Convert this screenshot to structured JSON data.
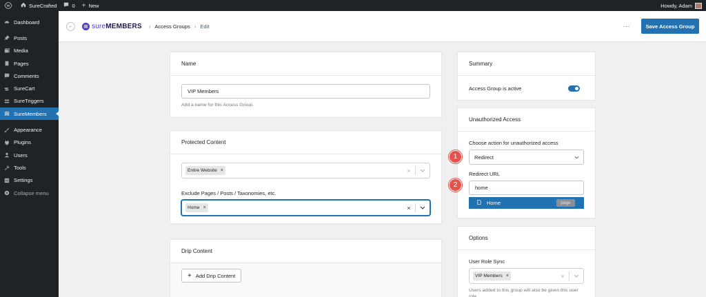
{
  "admin_bar": {
    "site_name": "SureCrafted",
    "comments_count": "0",
    "new_label": "New",
    "howdy": "Howdy, Adam"
  },
  "sidebar": {
    "items": [
      {
        "label": "Dashboard",
        "icon": "dashboard-icon"
      },
      {
        "label": "Posts",
        "icon": "pin-icon"
      },
      {
        "label": "Media",
        "icon": "media-icon"
      },
      {
        "label": "Pages",
        "icon": "pages-icon"
      },
      {
        "label": "Comments",
        "icon": "comment-icon"
      },
      {
        "label": "SureCart",
        "icon": "surecart-icon"
      },
      {
        "label": "SureTriggers",
        "icon": "suretriggers-icon"
      },
      {
        "label": "SureMembers",
        "icon": "suremembers-icon"
      },
      {
        "label": "Appearance",
        "icon": "brush-icon"
      },
      {
        "label": "Plugins",
        "icon": "plugin-icon"
      },
      {
        "label": "Users",
        "icon": "users-icon"
      },
      {
        "label": "Tools",
        "icon": "wrench-icon"
      },
      {
        "label": "Settings",
        "icon": "settings-icon"
      }
    ],
    "collapse_label": "Collapse menu"
  },
  "header": {
    "logo_prefix": "sure",
    "logo_suffix": "MEMBERS",
    "breadcrumb_parent": "Access Groups",
    "breadcrumb_current": "Edit",
    "save_label": "Save Access Group"
  },
  "name_card": {
    "title": "Name",
    "value": "VIP Members",
    "help": "Add a name for this Access Group."
  },
  "protected_card": {
    "title": "Protected Content",
    "include_tag": "Entire Website",
    "exclude_label": "Exclude Pages / Posts / Taxonomies, etc.",
    "exclude_tag": "Home"
  },
  "drip_card": {
    "title": "Drip Content",
    "add_label": "Add Drip Content"
  },
  "summary_card": {
    "title": "Summary",
    "active_label": "Access Group is active",
    "active": true
  },
  "unauth_card": {
    "title": "Unauthorized Access",
    "action_label": "Choose action for unauthorized access",
    "action_value": "Redirect",
    "redirect_label": "Redirect URL",
    "redirect_value": "home",
    "suggestion_label": "Home",
    "suggestion_badge": "page"
  },
  "options_card": {
    "title": "Options",
    "role_sync_label": "User Role Sync",
    "role_tag": "VIP Members",
    "help": "Users added to this group will also be given this user role."
  },
  "callouts": [
    "1",
    "2"
  ],
  "colors": {
    "primary": "#2271b1",
    "admin_dark": "#1d2327",
    "callout": "#e5524a",
    "brand": "#4338ca"
  }
}
